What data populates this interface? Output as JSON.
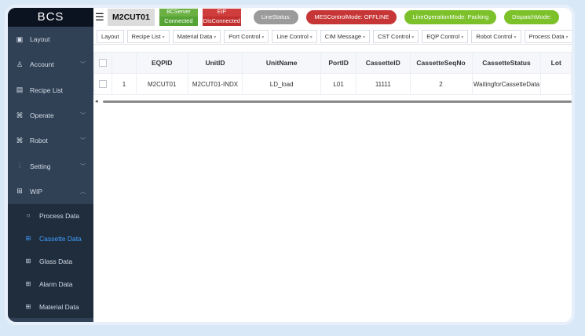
{
  "app": {
    "logo": "BCS",
    "equipment": "M2CUT01"
  },
  "status": {
    "bcserver": {
      "label": "BCServer",
      "value": "Connected"
    },
    "eip": {
      "label": "EIP",
      "value": "DisConnected"
    },
    "pills": [
      {
        "text": "LineStatus:",
        "color": "#9b9b9b"
      },
      {
        "text": "MESControlMode: OFFLINE",
        "color": "#c73636"
      },
      {
        "text": "LineOperationMode: Packing",
        "color": "#7cc12a"
      },
      {
        "text": "DispatchMode:",
        "color": "#7cc12a"
      }
    ]
  },
  "sidebar": {
    "items": [
      {
        "label": "Layout",
        "icon": "monitor-icon",
        "glyph": "▣",
        "has_children": false
      },
      {
        "label": "Account",
        "icon": "user-icon",
        "glyph": "♙",
        "has_children": true
      },
      {
        "label": "Recipe List",
        "icon": "document-icon",
        "glyph": "▤",
        "has_children": false
      },
      {
        "label": "Operate",
        "icon": "command-icon",
        "glyph": "⌘",
        "has_children": true
      },
      {
        "label": "Robot",
        "icon": "robot-icon",
        "glyph": "⌘",
        "has_children": true
      },
      {
        "label": "Setting",
        "icon": "sliders-icon",
        "glyph": "⫶",
        "has_children": true
      },
      {
        "label": "WIP",
        "icon": "grid-icon",
        "glyph": "⊞",
        "has_children": true,
        "expanded": true
      }
    ],
    "sub_items": [
      {
        "label": "Process Data",
        "icon": "circle-icon",
        "glyph": "○",
        "active": false
      },
      {
        "label": "Cassette Data",
        "icon": "table-icon",
        "glyph": "⊞",
        "active": true
      },
      {
        "label": "Glass Data",
        "icon": "table-icon",
        "glyph": "⊞",
        "active": false
      },
      {
        "label": "Alarm Data",
        "icon": "table-icon",
        "glyph": "⊞",
        "active": false
      },
      {
        "label": "Material Data",
        "icon": "table-icon",
        "glyph": "⊞",
        "active": false
      }
    ]
  },
  "tabs": [
    {
      "label": "Layout",
      "has_dropdown": false
    },
    {
      "label": "Recipe List",
      "has_dropdown": true
    },
    {
      "label": "Material Data",
      "has_dropdown": true
    },
    {
      "label": "Port Control",
      "has_dropdown": true
    },
    {
      "label": "Line Control",
      "has_dropdown": true
    },
    {
      "label": "CIM Message",
      "has_dropdown": true
    },
    {
      "label": "CST Control",
      "has_dropdown": true
    },
    {
      "label": "EQP Control",
      "has_dropdown": true
    },
    {
      "label": "Robot Control",
      "has_dropdown": true
    },
    {
      "label": "Process Data",
      "has_dropdown": true
    }
  ],
  "table": {
    "columns": [
      "",
      "",
      "EQPID",
      "UnitID",
      "UnitName",
      "PortID",
      "CassetteID",
      "CassetteSeqNo",
      "CassetteStatus",
      "Lot"
    ],
    "rows": [
      [
        "",
        "1",
        "M2CUT01",
        "M2CUT01-INDX",
        "LD_load",
        "L01",
        "11111",
        "2",
        "WaitingforCassetteData",
        ""
      ]
    ]
  },
  "colors": {
    "sidebar_bg": "#304156",
    "submenu_bg": "#1f2d3d",
    "active": "#409eff"
  }
}
